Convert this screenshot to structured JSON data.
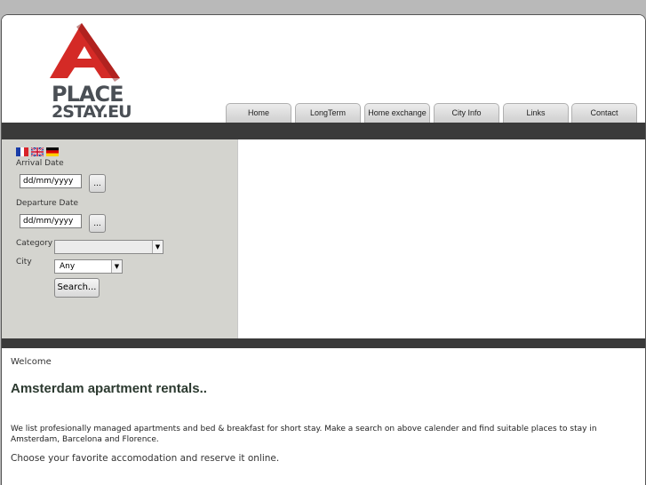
{
  "logo": {
    "line1": "PLACE",
    "line2": "2STAY.EU",
    "accent_color": "#d42a26"
  },
  "nav": {
    "tabs": [
      {
        "label": "Home"
      },
      {
        "label": "LongTerm"
      },
      {
        "label": "Home exchange"
      },
      {
        "label": "City Info"
      },
      {
        "label": "Links"
      },
      {
        "label": "Contact"
      }
    ]
  },
  "languages": [
    "flag-fr-icon",
    "flag-uk-icon",
    "flag-de-icon"
  ],
  "search": {
    "arrival_label": "Arrival Date",
    "arrival_value": "dd/mm/yyyy",
    "departure_label": "Departure Date",
    "departure_value": "dd/mm/yyyy",
    "date_picker_label": "...",
    "category_label": "Category",
    "category_value": "",
    "city_label": "City",
    "city_value": "Any",
    "search_button": "Search..."
  },
  "content": {
    "welcome": "Welcome",
    "heading": "Amsterdam apartment rentals..",
    "paragraph1": "We list profesionally managed apartments and bed & breakfast for short stay. Make a search on above calender and find suitable places to stay in Amsterdam, Barcelona and Florence.",
    "paragraph2": "Choose your favorite accomodation and reserve it online."
  }
}
